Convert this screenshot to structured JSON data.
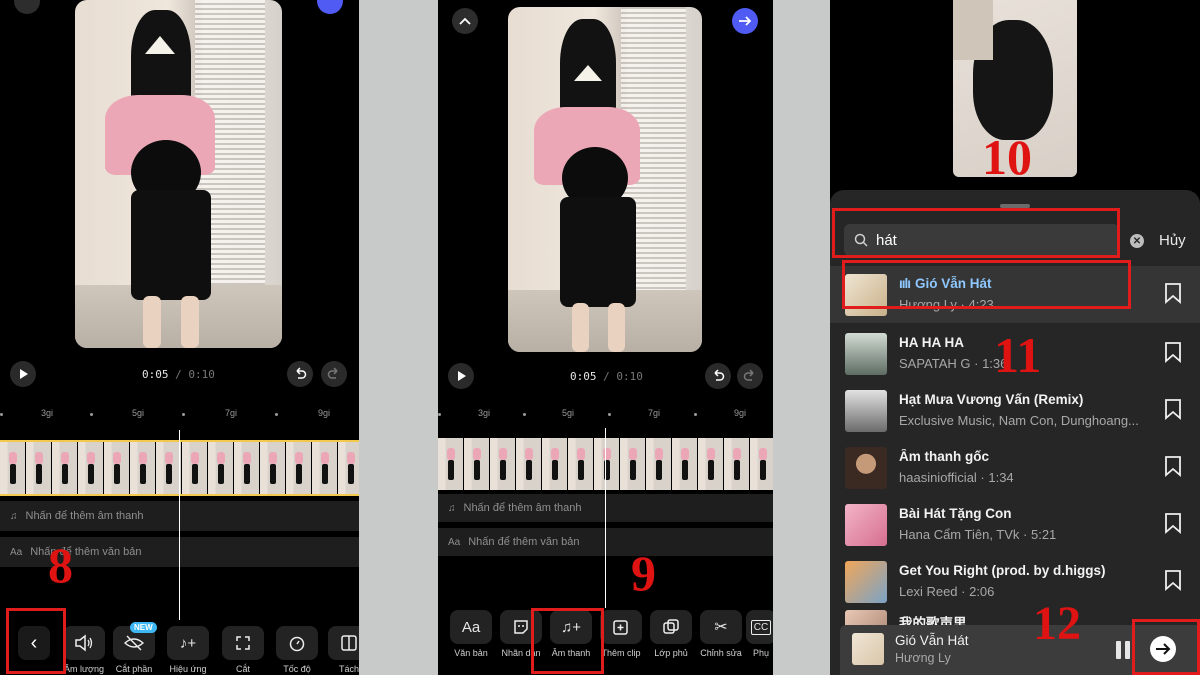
{
  "left_panel": {
    "time_current": "0:05",
    "time_separator": " / ",
    "time_total": "0:10",
    "ruler": [
      "3gi",
      "5gi",
      "7gi",
      "9gi"
    ],
    "audio_track": "Nhấn để thêm âm thanh",
    "text_track": "Nhấn để thêm văn bản",
    "new_badge": "NEW",
    "tools": [
      "Âm lượng",
      "Cắt phần",
      "Hiệu ứng",
      "Cắt",
      "Tốc độ",
      "Tách"
    ],
    "step_number": "8"
  },
  "middle_panel": {
    "time_current": "0:05",
    "time_separator": " / ",
    "time_total": "0:10",
    "ruler": [
      "3gi",
      "5gi",
      "7gi",
      "9gi"
    ],
    "audio_track": "Nhấn để thêm âm thanh",
    "text_track": "Nhấn để thêm văn bản",
    "tools": [
      "Văn bản",
      "Nhãn dán",
      "Âm thanh",
      "Thêm clip",
      "Lớp phủ",
      "Chỉnh sửa",
      "Phụ"
    ],
    "text_tool_glyph": "Aa",
    "cc_glyph": "CC",
    "step_number": "9"
  },
  "right_panel": {
    "search_value": "hát",
    "cancel_label": "Hủy",
    "songs": [
      {
        "title": "Gió Vẫn Hát",
        "subtitle": "Hương Ly · 4:23",
        "playing": true
      },
      {
        "title": "HA HA HA",
        "subtitle": "SAPATAH G · 1:36"
      },
      {
        "title": "Hạt Mưa Vương Vấn (Remix)",
        "subtitle": "Exclusive Music, Nam Con, Dunghoang..."
      },
      {
        "title": "Âm thanh gốc",
        "subtitle": "haasiniofficial · 1:34"
      },
      {
        "title": "Bài Hát Tặng Con",
        "subtitle": "Hana Cẩm Tiên, TVk · 5:21"
      },
      {
        "title": "Get You Right (prod. by d.higgs)",
        "subtitle": "Lexi Reed · 2:06"
      },
      {
        "title": "我的歌声里",
        "subtitle": ""
      }
    ],
    "now_playing": {
      "title": "Gió Vẫn Hát",
      "artist": "Hương Ly"
    },
    "step_numbers": {
      "preview": "10",
      "song": "11",
      "next": "12"
    }
  },
  "colors": {
    "accent_blue": "#4f5bf3",
    "annotation_red": "#e11c1c",
    "playing_blue": "#8ec8ff",
    "timeline_yellow": "#f2c94c"
  }
}
